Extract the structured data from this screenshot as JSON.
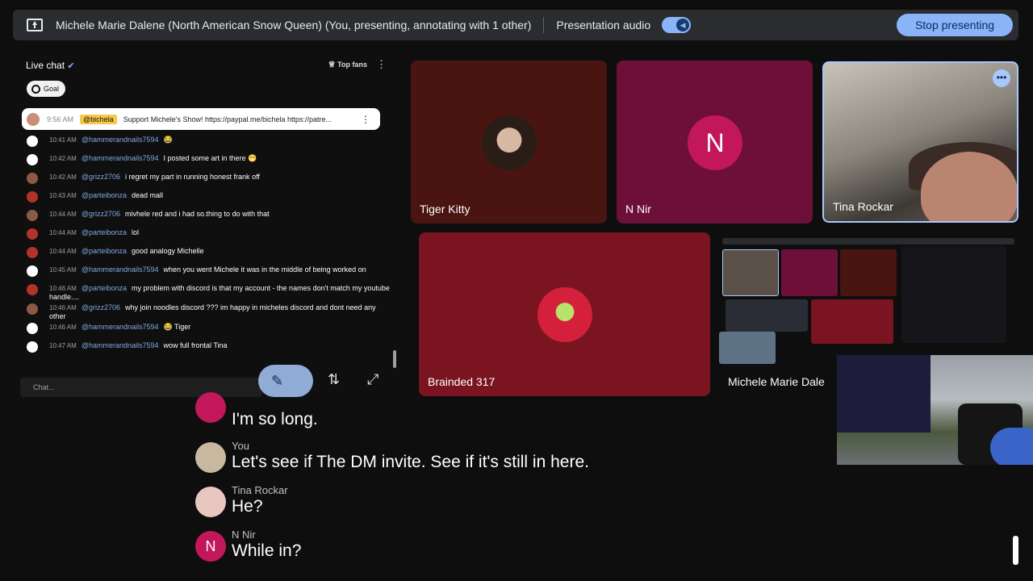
{
  "topbar": {
    "title": "Michele Marie Dalene (North American Snow Queen) (You, presenting, annotating with 1 other)",
    "audio_label": "Presentation audio",
    "stop_label": "Stop presenting"
  },
  "chat": {
    "header": "Live chat",
    "top_fans": "Top fans",
    "goal": "Goal",
    "pinned": {
      "time": "9:56 AM",
      "handle": "@bichela",
      "message": "Support Michele's Show! https://paypal.me/bichela https://patre..."
    },
    "messages": [
      {
        "time": "10:41 AM",
        "handle": "@hammerandnails7594",
        "text": "😂",
        "color": "#ffffff"
      },
      {
        "time": "10:42 AM",
        "handle": "@hammerandnails7594",
        "text": "I posted some art in there 😁",
        "color": "#ffffff"
      },
      {
        "time": "10:42 AM",
        "handle": "@grizz2706",
        "text": "i regret my part in running honest frank off",
        "color": "#8a5a44"
      },
      {
        "time": "10:43 AM",
        "handle": "@parteibonza",
        "text": "dead mall",
        "color": "#b2332a"
      },
      {
        "time": "10:44 AM",
        "handle": "@grizz2706",
        "text": "mivhele red and i had so.thing to do with that",
        "color": "#8a5a44"
      },
      {
        "time": "10:44 AM",
        "handle": "@parteibonza",
        "text": "lol",
        "color": "#b2332a"
      },
      {
        "time": "10:44 AM",
        "handle": "@parteibonza",
        "text": "good analogy Michelle",
        "color": "#b2332a"
      },
      {
        "time": "10:45 AM",
        "handle": "@hammerandnails7594",
        "text": "when you went Michele it was in the middle of being worked on",
        "color": "#ffffff"
      },
      {
        "time": "10:46 AM",
        "handle": "@parteibonza",
        "text": "my problem with discord is that my account - the names don't match my youtube handle....",
        "color": "#b2332a"
      },
      {
        "time": "10:46 AM",
        "handle": "@grizz2706",
        "text": "why join noodles discord ??? im happy in micheles discord and dont need any other",
        "color": "#8a5a44"
      },
      {
        "time": "10:46 AM",
        "handle": "@hammerandnails7594",
        "text": "😂 Tiger",
        "color": "#ffffff"
      },
      {
        "time": "10:47 AM",
        "handle": "@hammerandnails7594",
        "text": "wow full frontal Tina",
        "color": "#ffffff"
      }
    ],
    "input_placeholder": "Chat..."
  },
  "tiles": {
    "tiger": {
      "name": "Tiger Kitty"
    },
    "nnir": {
      "name": "N Nir",
      "initial": "N"
    },
    "tina": {
      "name": "Tina Rockar"
    },
    "braindead": {
      "name": "Brainded 317"
    },
    "michele": {
      "name": "Michele Marie Dale"
    }
  },
  "captions": [
    {
      "name": "",
      "text": "I'm so long.",
      "avatar": "",
      "color": "#c2185b"
    },
    {
      "name": "You",
      "text": "Let's see if The DM invite. See if it's still in here.",
      "avatar": "",
      "color": "#c9b8a0"
    },
    {
      "name": "Tina Rockar",
      "text": "He?",
      "avatar": "",
      "color": "#e8c7c0"
    },
    {
      "name": "N Nir",
      "text": "While in?",
      "avatar": "N",
      "color": "#c2185b"
    }
  ],
  "colors": {
    "accent": "#8ab4f8",
    "tile_magenta": "#6d0f38",
    "tile_maroon": "#4a1410",
    "tile_red": "#7a1421"
  }
}
